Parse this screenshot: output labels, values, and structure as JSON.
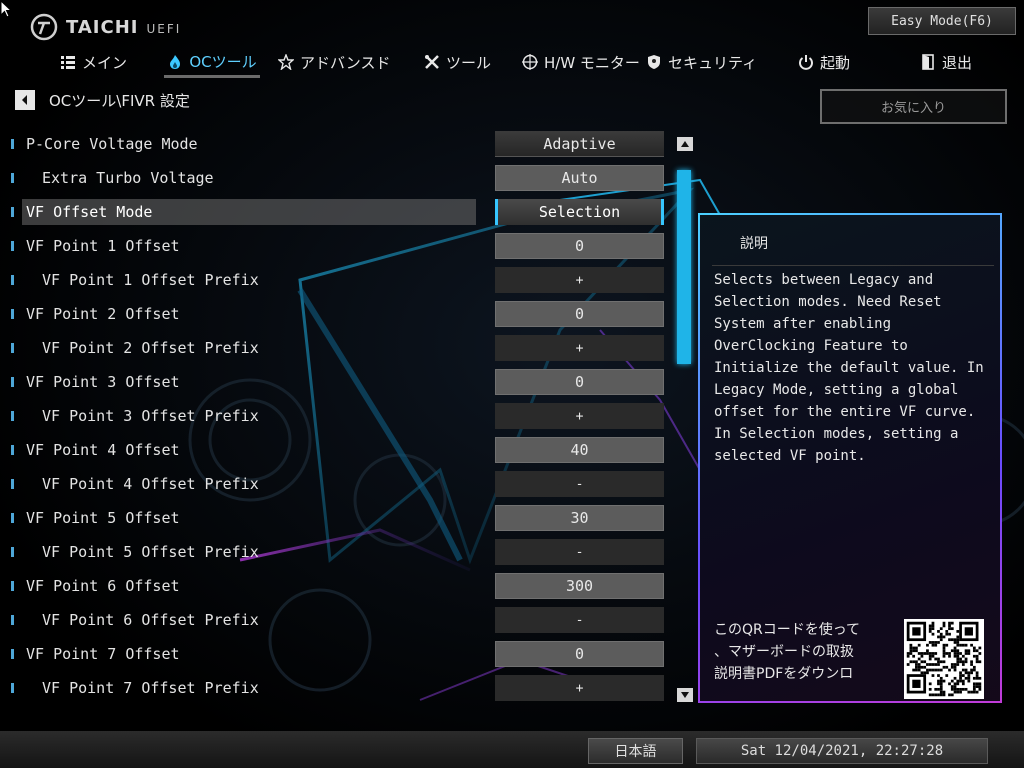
{
  "brand": {
    "name": "TAICHI",
    "sub": "UEFI"
  },
  "easy_mode_label": "Easy Mode(F6)",
  "nav": {
    "tabs": [
      {
        "label": "メイン",
        "icon": "list-icon"
      },
      {
        "label": "OCツール",
        "icon": "flame-icon",
        "active": true
      },
      {
        "label": "アドバンスド",
        "icon": "star-icon"
      },
      {
        "label": "ツール",
        "icon": "tools-icon"
      },
      {
        "label": "H/W モニター",
        "icon": "crosshair-icon"
      },
      {
        "label": "セキュリティ",
        "icon": "shield-icon"
      },
      {
        "label": "起動",
        "icon": "power-icon"
      },
      {
        "label": "退出",
        "icon": "exit-door-icon"
      }
    ]
  },
  "breadcrumb": "OCツール\\FIVR 設定",
  "favorites_label": "お気に入り",
  "settings": [
    {
      "label": "P-Core Voltage Mode",
      "value": "Adaptive",
      "indent": false,
      "kind": "select"
    },
    {
      "label": "Extra Turbo Voltage",
      "value": "Auto",
      "indent": true,
      "kind": "input"
    },
    {
      "label": "VF Offset Mode",
      "value": "Selection",
      "indent": false,
      "kind": "focus",
      "selected": true
    },
    {
      "label": "VF Point 1 Offset",
      "value": "0",
      "indent": false,
      "kind": "input"
    },
    {
      "label": "VF Point 1 Offset Prefix",
      "value": "+",
      "indent": true,
      "kind": "sign"
    },
    {
      "label": "VF Point 2 Offset",
      "value": "0",
      "indent": false,
      "kind": "input"
    },
    {
      "label": "VF Point 2 Offset Prefix",
      "value": "+",
      "indent": true,
      "kind": "sign"
    },
    {
      "label": "VF Point 3 Offset",
      "value": "0",
      "indent": false,
      "kind": "input"
    },
    {
      "label": "VF Point 3 Offset Prefix",
      "value": "+",
      "indent": true,
      "kind": "sign"
    },
    {
      "label": "VF Point 4 Offset",
      "value": "40",
      "indent": false,
      "kind": "input"
    },
    {
      "label": "VF Point 4 Offset Prefix",
      "value": "-",
      "indent": true,
      "kind": "sign"
    },
    {
      "label": "VF Point 5 Offset",
      "value": "30",
      "indent": false,
      "kind": "input"
    },
    {
      "label": "VF Point 5 Offset Prefix",
      "value": "-",
      "indent": true,
      "kind": "sign"
    },
    {
      "label": "VF Point 6 Offset",
      "value": "300",
      "indent": false,
      "kind": "input"
    },
    {
      "label": "VF Point 6 Offset Prefix",
      "value": "-",
      "indent": true,
      "kind": "sign"
    },
    {
      "label": "VF Point 7 Offset",
      "value": "0",
      "indent": false,
      "kind": "input"
    },
    {
      "label": "VF Point 7 Offset Prefix",
      "value": "+",
      "indent": true,
      "kind": "sign"
    }
  ],
  "description": {
    "title": "説明",
    "body": "Selects between Legacy and\nSelection modes. Need Reset\nSystem after enabling\nOverClocking Feature to\nInitialize the default value. In\nLegacy Mode, setting a global\noffset for the entire VF curve.\nIn Selection modes, setting a\nselected VF point.",
    "qr_text": "このQRコードを使って\n、マザーボードの取扱\n説明書PDFをダウンロ"
  },
  "status": {
    "language": "日本語",
    "datetime": "Sat 12/04/2021, 22:27:28"
  },
  "colors": {
    "accent": "#1fb4e8",
    "active_tab": "#5fd0ff",
    "panel_border_start": "#4bd1ff",
    "panel_border_end": "#c23bd8"
  }
}
